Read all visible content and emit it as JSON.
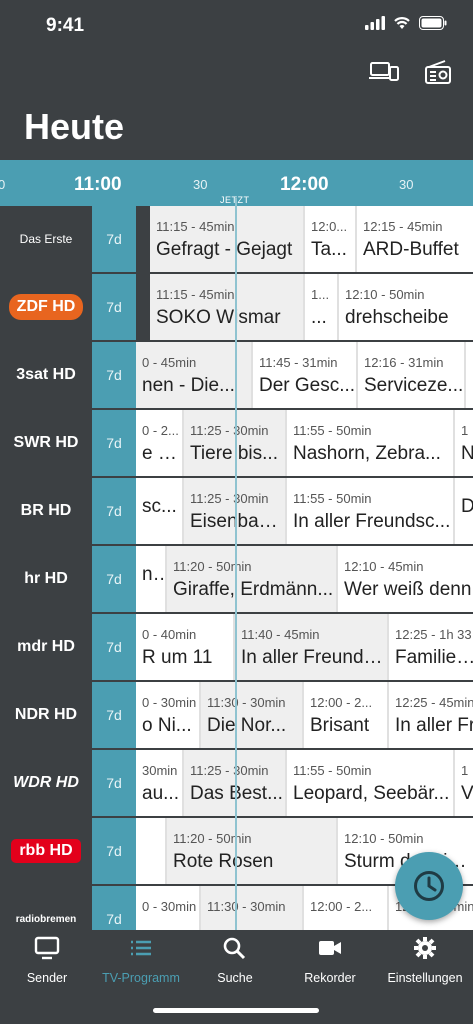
{
  "status": {
    "time": "9:41"
  },
  "header": {
    "title": "Heute"
  },
  "timebar": {
    "ticks": [
      {
        "label": "0",
        "kind": "small"
      },
      {
        "label": "11:00",
        "kind": "big"
      },
      {
        "label": "30",
        "kind": "small"
      },
      {
        "label": "12:00",
        "kind": "big"
      },
      {
        "label": "30",
        "kind": "small"
      }
    ],
    "now_label": "JETZT"
  },
  "archive_label": "7d",
  "channels": [
    {
      "name": "Das Erste",
      "logo": "das-erste-logo",
      "programs": [
        {
          "meta": "11:15 - 45min",
          "title": "Gefragt - Gejagt",
          "state": "now"
        },
        {
          "meta": "12:0...",
          "title": "Ta...",
          "state": "future"
        },
        {
          "meta": "12:15 - 45min",
          "title": "ARD-Buffet",
          "state": "future"
        }
      ]
    },
    {
      "name": "ZDF HD",
      "logo": "zdf-hd-logo",
      "programs": [
        {
          "meta": "11:15 - 45min",
          "title": "SOKO Wismar",
          "state": "now"
        },
        {
          "meta": "1...",
          "title": "...",
          "state": "future"
        },
        {
          "meta": "12:10 - 50min",
          "title": "drehscheibe",
          "state": "future"
        }
      ]
    },
    {
      "name": "3sat HD",
      "logo": "3sat-hd-logo",
      "programs": [
        {
          "meta": "0 - 45min",
          "title": "nen - Die...",
          "state": "now"
        },
        {
          "meta": "11:45 - 31min",
          "title": "Der Gesc...",
          "state": "future"
        },
        {
          "meta": "12:16 - 31min",
          "title": "Serviceze...",
          "state": "future"
        },
        {
          "meta": "",
          "title": "",
          "state": "future"
        }
      ]
    },
    {
      "name": "SWR HD",
      "logo": "swr-hd-logo",
      "programs": [
        {
          "meta": "0 - 2...",
          "title": "e b...",
          "state": "future"
        },
        {
          "meta": "11:25 - 30min",
          "title": "Tiere bis...",
          "state": "now"
        },
        {
          "meta": "11:55 - 50min",
          "title": "Nashorn, Zebra...",
          "state": "future"
        },
        {
          "meta": "1",
          "title": "N",
          "state": "future"
        }
      ]
    },
    {
      "name": "BR HD",
      "logo": "br-hd-logo",
      "programs": [
        {
          "meta": "",
          "title": "sc...",
          "state": "future"
        },
        {
          "meta": "11:25 - 30min",
          "title": "Eisenbah...",
          "state": "now"
        },
        {
          "meta": "11:55 - 50min",
          "title": "In aller Freundsc...",
          "state": "future"
        },
        {
          "meta": "",
          "title": "D",
          "state": "future"
        }
      ]
    },
    {
      "name": "hr HD",
      "logo": "hr-hd-logo",
      "programs": [
        {
          "meta": "",
          "title": "n...",
          "state": "future"
        },
        {
          "meta": "11:20 - 50min",
          "title": "Giraffe, Erdmänn...",
          "state": "now"
        },
        {
          "meta": "12:10 - 45min",
          "title": "Wer weiß denn",
          "state": "future"
        }
      ]
    },
    {
      "name": "mdr HD",
      "logo": "mdr-hd-logo",
      "programs": [
        {
          "meta": "0 - 40min",
          "title": "R um 11",
          "state": "future"
        },
        {
          "meta": "11:40 - 45min",
          "title": "In aller Freunds...",
          "state": "now"
        },
        {
          "meta": "12:25 - 1h 33",
          "title": "Familie Re",
          "state": "future"
        }
      ]
    },
    {
      "name": "NDR HD",
      "logo": "ndr-hd-logo",
      "programs": [
        {
          "meta": "0 - 30min",
          "title": "o Ni...",
          "state": "future"
        },
        {
          "meta": "11:30 - 30min",
          "title": "Die Nor...",
          "state": "now"
        },
        {
          "meta": "12:00 - 2...",
          "title": "Brisant",
          "state": "future"
        },
        {
          "meta": "12:25 - 45min",
          "title": "In aller Fr",
          "state": "future"
        }
      ]
    },
    {
      "name": "WDR HD",
      "logo": "wdr-hd-logo",
      "programs": [
        {
          "meta": "30min",
          "title": "au...",
          "state": "future"
        },
        {
          "meta": "11:25 - 30min",
          "title": "Das Best...",
          "state": "now"
        },
        {
          "meta": "11:55 - 50min",
          "title": "Leopard, Seebär...",
          "state": "future"
        },
        {
          "meta": "1",
          "title": "V",
          "state": "future"
        }
      ]
    },
    {
      "name": "rbb HD",
      "logo": "rbb-hd-logo",
      "programs": [
        {
          "meta": "",
          "title": "",
          "state": "future"
        },
        {
          "meta": "11:20 - 50min",
          "title": "Rote Rosen",
          "state": "now"
        },
        {
          "meta": "12:10 - 50min",
          "title": "Sturm der Liebe",
          "state": "future"
        }
      ]
    },
    {
      "name": "radiobremen",
      "logo": "radio-bremen-logo",
      "programs": [
        {
          "meta": "0 - 30min",
          "title": "",
          "state": "future"
        },
        {
          "meta": "11:30 - 30min",
          "title": "",
          "state": "now"
        },
        {
          "meta": "12:00 - 2...",
          "title": "",
          "state": "future"
        },
        {
          "meta": "12:25 - 45min",
          "title": "",
          "state": "future"
        }
      ]
    }
  ],
  "tabs": [
    {
      "label": "Sender",
      "icon": "tv-icon",
      "active": false
    },
    {
      "label": "TV-Programm",
      "icon": "list-icon",
      "active": true
    },
    {
      "label": "Suche",
      "icon": "search-icon",
      "active": false
    },
    {
      "label": "Rekorder",
      "icon": "video-camera-icon",
      "active": false
    },
    {
      "label": "Einstellungen",
      "icon": "gear-icon",
      "active": false
    }
  ],
  "colors": {
    "accent": "#4b9eb2",
    "background": "#3c4043",
    "past_cell": "#efefef",
    "future_cell": "#ffffff"
  }
}
